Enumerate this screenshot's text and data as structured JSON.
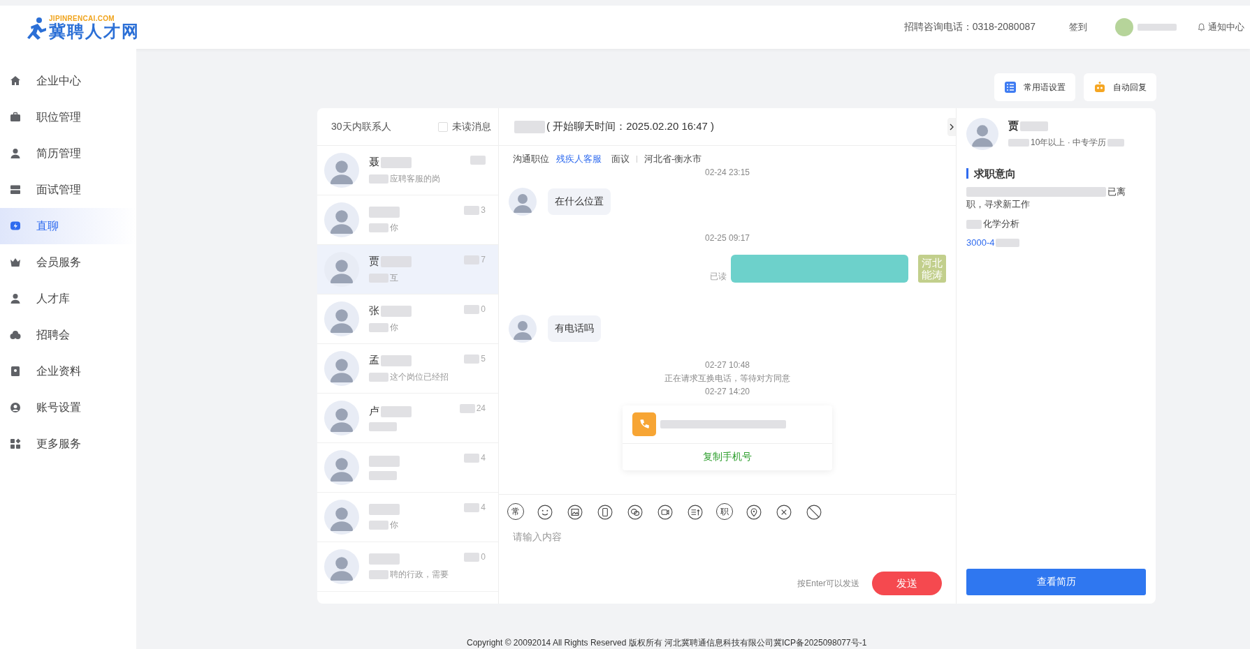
{
  "header": {
    "logo_domain": "JIPINRENCAI.COM",
    "logo_name": "冀聘人才网",
    "hotline": "招聘咨询电话：0318-2080087",
    "sign_in": "签到",
    "notifications": "通知中心"
  },
  "sidebar": {
    "items": [
      {
        "label": "企业中心",
        "selected": false
      },
      {
        "label": "职位管理",
        "selected": false
      },
      {
        "label": "简历管理",
        "selected": false
      },
      {
        "label": "面试管理",
        "selected": false
      },
      {
        "label": "直聊",
        "selected": true
      },
      {
        "label": "会员服务",
        "selected": false
      },
      {
        "label": "人才库",
        "selected": false
      },
      {
        "label": "招聘会",
        "selected": false
      },
      {
        "label": "企业资料",
        "selected": false
      },
      {
        "label": "账号设置",
        "selected": false
      },
      {
        "label": "更多服务",
        "selected": false
      }
    ]
  },
  "top_buttons": [
    "常用语设置",
    "自动回复"
  ],
  "contacts": {
    "title": "30天内联系人",
    "unread_filter": {
      "label": "未读消息",
      "checked": false
    },
    "items": [
      {
        "name": "聂",
        "preview": "应聘客服的岗",
        "selected": false
      },
      {
        "preview": "你",
        "time": "3",
        "selected": false
      },
      {
        "name": "贾",
        "preview": "互",
        "time": "7",
        "selected": true
      },
      {
        "name": "张",
        "preview": "你",
        "time": "0",
        "selected": false
      },
      {
        "name": "孟",
        "preview": "这个岗位已经招",
        "time": "5",
        "selected": false
      },
      {
        "name": "卢",
        "time": "24",
        "selected": false
      },
      {
        "time": "4",
        "selected": false
      },
      {
        "preview": "你",
        "time": "4",
        "selected": false
      },
      {
        "preview": "聘的行政，需要",
        "time": "0",
        "selected": false
      }
    ]
  },
  "chat": {
    "header": "( 开始聊天时间：2025.02.20 16:47 )",
    "job_label": "沟通职位",
    "job": "残疾人客服",
    "salary": "面议",
    "location": "河北省-衡水市",
    "messages": [
      {
        "kind": "time",
        "text": "02-24 23:15"
      },
      {
        "kind": "received",
        "text": "在什么位置"
      },
      {
        "kind": "time",
        "text": "02-25 09:17"
      },
      {
        "kind": "sent",
        "status": "已读",
        "avatar_text": "河北能涛"
      },
      {
        "kind": "received",
        "text": "有电话吗"
      },
      {
        "kind": "time",
        "text": "02-27 10:48"
      },
      {
        "kind": "system",
        "text": "正在请求互换电话，等待对方同意"
      },
      {
        "kind": "time",
        "text": "02-27 14:20"
      },
      {
        "kind": "phone_card",
        "action": "复制手机号"
      }
    ],
    "toolbar": [
      {
        "kind": "text",
        "text": "常"
      },
      {
        "kind": "smile"
      },
      {
        "kind": "image"
      },
      {
        "kind": "phone"
      },
      {
        "kind": "wechat"
      },
      {
        "kind": "video"
      },
      {
        "kind": "resume"
      },
      {
        "kind": "text",
        "text": "职"
      },
      {
        "kind": "pin"
      },
      {
        "kind": "close"
      },
      {
        "kind": "block"
      }
    ],
    "input": {
      "placeholder": "请输入内容"
    },
    "send_hint": "按Enter可以发送",
    "send": "发送"
  },
  "profile": {
    "name": "贾",
    "meta": "10年以上 · 中专学历",
    "section": "求职意向",
    "intent_line1": "已离",
    "intent_line2": "职，寻求新工作",
    "category": "化学分析",
    "salary": "3000-4",
    "button": "查看简历"
  },
  "footer": "Copyright © 20092014 All Rights Reserved 版权所有 河北冀聘通信息科技有限公司冀ICP备2025098077号-1"
}
